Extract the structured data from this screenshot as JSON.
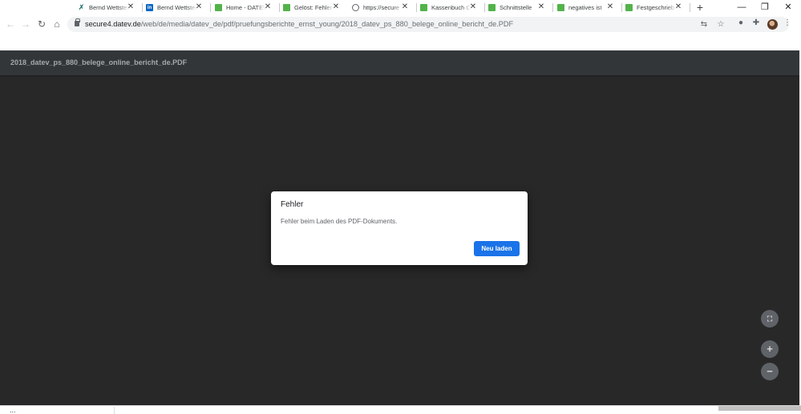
{
  "browser": {
    "tabs": [
      {
        "title": "Bernd Wettstein",
        "favicon": "xing-icon"
      },
      {
        "title": "Bernd Wettstein",
        "favicon": "linkedin-icon"
      },
      {
        "title": "Home - DATEV",
        "favicon": "green-page-icon"
      },
      {
        "title": "Gelöst: Fehler",
        "favicon": "green-page-icon"
      },
      {
        "title": "https://secure",
        "favicon": "globe-icon",
        "active": true
      },
      {
        "title": "Kassenbuch C",
        "favicon": "green-page-icon"
      },
      {
        "title": "Schnittstelle",
        "favicon": "green-page-icon"
      },
      {
        "title": "negatives ist",
        "favicon": "green-page-icon"
      },
      {
        "title": "Festgeschrieb",
        "favicon": "green-page-icon"
      }
    ],
    "close_glyph": "✕",
    "new_tab_glyph": "+",
    "window_controls": {
      "minimize": "—",
      "maximize": "❐",
      "close": "✕"
    },
    "url_host": "secure4.datev.de",
    "url_path": "/web/de/media/datev_de/pdf/pruefungsberichte_ernst_young/2018_datev_ps_880_belege_online_bericht_de.PDF"
  },
  "viewer": {
    "doc_title": "2018_datev_ps_880_belege_online_bericht_de.PDF",
    "fit_glyph": "⛶",
    "zoom_in_glyph": "+",
    "zoom_out_glyph": "−"
  },
  "dialog": {
    "title": "Fehler",
    "message": "Fehler beim Laden des PDF-Dokuments.",
    "button_label": "Neu laden"
  },
  "bottom": {
    "dots": "..."
  },
  "colors": {
    "accent": "#1a73e8",
    "viewer_bg": "#282828",
    "viewer_toolbar": "#323639"
  }
}
